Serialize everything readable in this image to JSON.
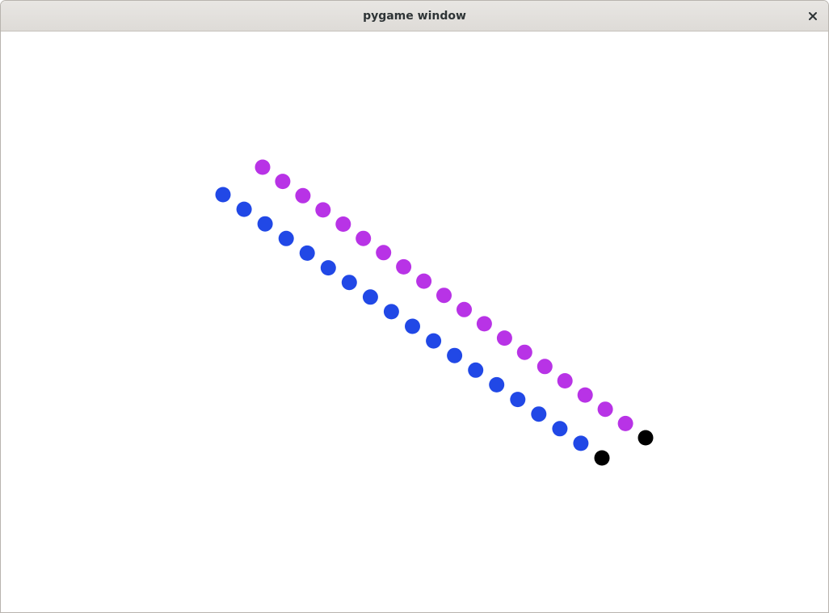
{
  "window": {
    "title": "pygame window"
  },
  "icons": {
    "close": "close-icon"
  },
  "colors": {
    "background": "#ffffff",
    "snake_blue": "#2148e6",
    "snake_purple": "#b833e6",
    "head": "#000000"
  },
  "game": {
    "snakes": [
      {
        "color": "#2148e6",
        "head_color": "#000000",
        "segment_count": 19
      },
      {
        "color": "#b833e6",
        "head_color": "#000000",
        "segment_count": 20
      }
    ]
  }
}
